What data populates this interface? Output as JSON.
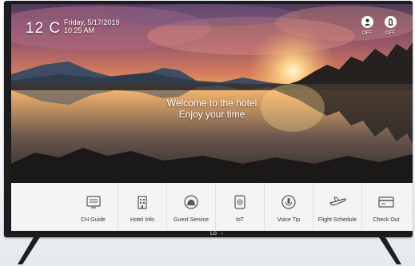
{
  "status": {
    "temperature": "12 C",
    "date": "Friday, 5/17/2019",
    "time": "10:25 AM"
  },
  "top_icons": [
    {
      "icon": "do-not-disturb-icon",
      "label": "OFF"
    },
    {
      "icon": "make-up-room-icon",
      "label": "OFF"
    }
  ],
  "welcome": {
    "line1": "Welcome to the hotel",
    "line2": "Enjoy your time"
  },
  "menu": [
    {
      "icon": "tv-guide-icon",
      "label": "CH Guide"
    },
    {
      "icon": "hotel-building-icon",
      "label": "Hotel Info"
    },
    {
      "icon": "room-service-bell-icon",
      "label": "Guest Service"
    },
    {
      "icon": "iot-device-icon",
      "label": "IoT"
    },
    {
      "icon": "microphone-icon",
      "label": "Voice Tip"
    },
    {
      "icon": "airplane-icon",
      "label": "Flight Schedule"
    },
    {
      "icon": "checkout-card-icon",
      "label": "Check Out"
    }
  ],
  "brand": "LG",
  "colors": {
    "menu_bg": "#f4f4f4",
    "bezel": "#1c1c1e",
    "sun": "#ffe7a0"
  }
}
